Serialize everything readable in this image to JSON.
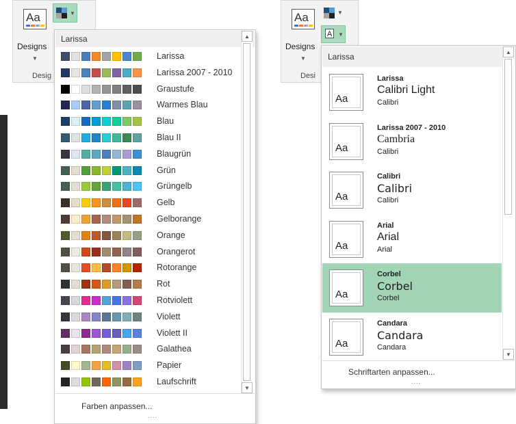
{
  "left": {
    "ribbon": {
      "designs_label": "Designs",
      "group_label": "Desig"
    },
    "dropdown": {
      "header": "Larissa",
      "footer": "Farben anpassen...",
      "grip": "....",
      "items": [
        {
          "name": "Larissa",
          "colors": [
            "#3b4e6e",
            "#e1e1e1",
            "#4a7db9",
            "#f08a2c",
            "#a5a5a5",
            "#ffc000",
            "#4a86d1",
            "#70ad47"
          ]
        },
        {
          "name": "Larissa 2007 - 2010",
          "colors": [
            "#1f3864",
            "#e7e6e6",
            "#4f81bd",
            "#c0504d",
            "#9bbb59",
            "#8064a2",
            "#4bacc6",
            "#f79646"
          ]
        },
        {
          "name": "Graustufe",
          "colors": [
            "#000000",
            "#ffffff",
            "#dddddd",
            "#b2b2b2",
            "#969696",
            "#808080",
            "#5f5f5f",
            "#4d4d4d"
          ]
        },
        {
          "name": "Warmes Blau",
          "colors": [
            "#242852",
            "#accbf9",
            "#4a66ac",
            "#629dd1",
            "#297fd5",
            "#7f8fa9",
            "#5aa2ae",
            "#9d90a0"
          ]
        },
        {
          "name": "Blau",
          "colors": [
            "#17406d",
            "#dbeff9",
            "#0f6fc6",
            "#009dd9",
            "#0bd0d9",
            "#10cf9b",
            "#7cca62",
            "#a5c249"
          ]
        },
        {
          "name": "Blau II",
          "colors": [
            "#335b74",
            "#dfe3e5",
            "#1cade4",
            "#2683c6",
            "#27ced7",
            "#42ba97",
            "#3e8853",
            "#62a39f"
          ]
        },
        {
          "name": "Blaugrün",
          "colors": [
            "#373545",
            "#dee6ef",
            "#4cb0a6",
            "#5ea8c6",
            "#4a80c2",
            "#92b7d3",
            "#ad9bd1",
            "#3d8fd0"
          ]
        },
        {
          "name": "Grün",
          "colors": [
            "#455f51",
            "#e3ded1",
            "#549e39",
            "#8ab833",
            "#c0cf3a",
            "#029676",
            "#4ab5c4",
            "#0989b1"
          ]
        },
        {
          "name": "Grüngelb",
          "colors": [
            "#455f51",
            "#e3ded1",
            "#99cb38",
            "#63a537",
            "#37a76f",
            "#44c1a3",
            "#4eb3cf",
            "#51c3f9"
          ]
        },
        {
          "name": "Gelb",
          "colors": [
            "#39302a",
            "#e5dec6",
            "#ffca08",
            "#f8931d",
            "#ce8d3e",
            "#ec7016",
            "#e64823",
            "#9c6a6a"
          ]
        },
        {
          "name": "Gelborange",
          "colors": [
            "#4e3b30",
            "#fbeec9",
            "#f0a22e",
            "#a5644e",
            "#b58b80",
            "#c3986d",
            "#a19574",
            "#c17529"
          ]
        },
        {
          "name": "Orange",
          "colors": [
            "#4e5b2f",
            "#e3ded1",
            "#e48312",
            "#bd582c",
            "#865640",
            "#9b8357",
            "#c2bc80",
            "#94a088"
          ]
        },
        {
          "name": "Orangerot",
          "colors": [
            "#505046",
            "#eeece1",
            "#d34817",
            "#9b2d1f",
            "#a28e6a",
            "#956251",
            "#918485",
            "#855d5d"
          ]
        },
        {
          "name": "Rotorange",
          "colors": [
            "#505046",
            "#e9e5dc",
            "#e84c22",
            "#ffbd47",
            "#b64926",
            "#ff8427",
            "#cc9900",
            "#b22600"
          ]
        },
        {
          "name": "Rot",
          "colors": [
            "#323232",
            "#e3ded1",
            "#a5300f",
            "#d55816",
            "#e19825",
            "#b19c7d",
            "#7f5f52",
            "#b27d49"
          ]
        },
        {
          "name": "Rotviolett",
          "colors": [
            "#454551",
            "#d8d9dc",
            "#e32d91",
            "#c830cc",
            "#4ea6dc",
            "#4775e7",
            "#8971e1",
            "#d54773"
          ]
        },
        {
          "name": "Violett",
          "colors": [
            "#373545",
            "#dcd8dc",
            "#ad84c6",
            "#8784c7",
            "#5d739a",
            "#6997af",
            "#84acb6",
            "#6f8183"
          ]
        },
        {
          "name": "Violett II",
          "colors": [
            "#632e62",
            "#eae5eb",
            "#92278f",
            "#9b57d3",
            "#755dd9",
            "#665eb8",
            "#45a5ed",
            "#5982db"
          ]
        },
        {
          "name": "Galathea",
          "colors": [
            "#4d3f3f",
            "#e2d4d0",
            "#a6785d",
            "#b3a375",
            "#b08a7e",
            "#c2a874",
            "#96af8d",
            "#9b8d8a"
          ]
        },
        {
          "name": "Papier",
          "colors": [
            "#444d26",
            "#fefac9",
            "#a5b592",
            "#f3a447",
            "#e7bc29",
            "#d092a7",
            "#9c85c0",
            "#809ec2"
          ]
        },
        {
          "name": "Laufschrift",
          "colors": [
            "#242424",
            "#dddddd",
            "#94c600",
            "#71685a",
            "#ff6700",
            "#909465",
            "#956b43",
            "#fea022"
          ]
        }
      ]
    }
  },
  "right": {
    "ribbon": {
      "designs_label": "Designs",
      "group_label": "Desi",
      "font_button_letter": "A"
    },
    "dropdown": {
      "header": "Larissa",
      "footer": "Schriftarten anpassen...",
      "grip": "....",
      "thumb_text": "Aa",
      "items": [
        {
          "title": "Larissa",
          "heading": "Calibri Light",
          "body": "Calibri",
          "selected": false
        },
        {
          "title": "Larissa 2007 - 2010",
          "heading": "Cambria",
          "body": "Calibri",
          "selected": false
        },
        {
          "title": "Calibri",
          "heading": "Calibri",
          "body": "Calibri",
          "selected": false
        },
        {
          "title": "Arial",
          "heading": "Arial",
          "body": "Arial",
          "selected": false
        },
        {
          "title": "Corbel",
          "heading": "Corbel",
          "body": "Corbel",
          "selected": true
        },
        {
          "title": "Candara",
          "heading": "Candara",
          "body": "Candara",
          "selected": false
        }
      ]
    }
  }
}
